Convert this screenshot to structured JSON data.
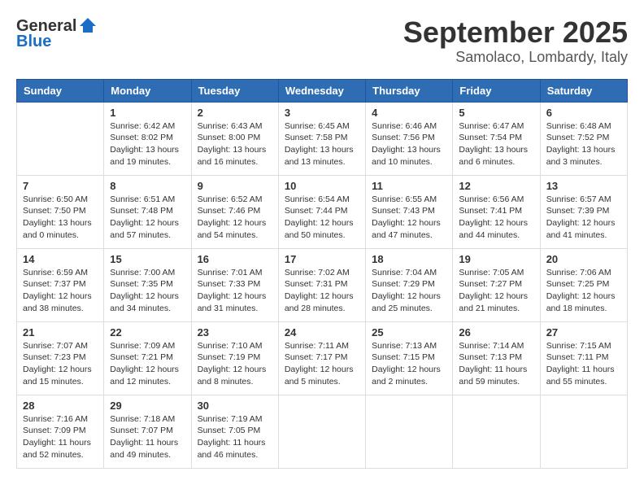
{
  "logo": {
    "general": "General",
    "blue": "Blue"
  },
  "title": "September 2025",
  "location": "Samolaco, Lombardy, Italy",
  "weekdays": [
    "Sunday",
    "Monday",
    "Tuesday",
    "Wednesday",
    "Thursday",
    "Friday",
    "Saturday"
  ],
  "weeks": [
    [
      {
        "day": null,
        "info": null
      },
      {
        "day": "1",
        "info": "Sunrise: 6:42 AM\nSunset: 8:02 PM\nDaylight: 13 hours\nand 19 minutes."
      },
      {
        "day": "2",
        "info": "Sunrise: 6:43 AM\nSunset: 8:00 PM\nDaylight: 13 hours\nand 16 minutes."
      },
      {
        "day": "3",
        "info": "Sunrise: 6:45 AM\nSunset: 7:58 PM\nDaylight: 13 hours\nand 13 minutes."
      },
      {
        "day": "4",
        "info": "Sunrise: 6:46 AM\nSunset: 7:56 PM\nDaylight: 13 hours\nand 10 minutes."
      },
      {
        "day": "5",
        "info": "Sunrise: 6:47 AM\nSunset: 7:54 PM\nDaylight: 13 hours\nand 6 minutes."
      },
      {
        "day": "6",
        "info": "Sunrise: 6:48 AM\nSunset: 7:52 PM\nDaylight: 13 hours\nand 3 minutes."
      }
    ],
    [
      {
        "day": "7",
        "info": "Sunrise: 6:50 AM\nSunset: 7:50 PM\nDaylight: 13 hours\nand 0 minutes."
      },
      {
        "day": "8",
        "info": "Sunrise: 6:51 AM\nSunset: 7:48 PM\nDaylight: 12 hours\nand 57 minutes."
      },
      {
        "day": "9",
        "info": "Sunrise: 6:52 AM\nSunset: 7:46 PM\nDaylight: 12 hours\nand 54 minutes."
      },
      {
        "day": "10",
        "info": "Sunrise: 6:54 AM\nSunset: 7:44 PM\nDaylight: 12 hours\nand 50 minutes."
      },
      {
        "day": "11",
        "info": "Sunrise: 6:55 AM\nSunset: 7:43 PM\nDaylight: 12 hours\nand 47 minutes."
      },
      {
        "day": "12",
        "info": "Sunrise: 6:56 AM\nSunset: 7:41 PM\nDaylight: 12 hours\nand 44 minutes."
      },
      {
        "day": "13",
        "info": "Sunrise: 6:57 AM\nSunset: 7:39 PM\nDaylight: 12 hours\nand 41 minutes."
      }
    ],
    [
      {
        "day": "14",
        "info": "Sunrise: 6:59 AM\nSunset: 7:37 PM\nDaylight: 12 hours\nand 38 minutes."
      },
      {
        "day": "15",
        "info": "Sunrise: 7:00 AM\nSunset: 7:35 PM\nDaylight: 12 hours\nand 34 minutes."
      },
      {
        "day": "16",
        "info": "Sunrise: 7:01 AM\nSunset: 7:33 PM\nDaylight: 12 hours\nand 31 minutes."
      },
      {
        "day": "17",
        "info": "Sunrise: 7:02 AM\nSunset: 7:31 PM\nDaylight: 12 hours\nand 28 minutes."
      },
      {
        "day": "18",
        "info": "Sunrise: 7:04 AM\nSunset: 7:29 PM\nDaylight: 12 hours\nand 25 minutes."
      },
      {
        "day": "19",
        "info": "Sunrise: 7:05 AM\nSunset: 7:27 PM\nDaylight: 12 hours\nand 21 minutes."
      },
      {
        "day": "20",
        "info": "Sunrise: 7:06 AM\nSunset: 7:25 PM\nDaylight: 12 hours\nand 18 minutes."
      }
    ],
    [
      {
        "day": "21",
        "info": "Sunrise: 7:07 AM\nSunset: 7:23 PM\nDaylight: 12 hours\nand 15 minutes."
      },
      {
        "day": "22",
        "info": "Sunrise: 7:09 AM\nSunset: 7:21 PM\nDaylight: 12 hours\nand 12 minutes."
      },
      {
        "day": "23",
        "info": "Sunrise: 7:10 AM\nSunset: 7:19 PM\nDaylight: 12 hours\nand 8 minutes."
      },
      {
        "day": "24",
        "info": "Sunrise: 7:11 AM\nSunset: 7:17 PM\nDaylight: 12 hours\nand 5 minutes."
      },
      {
        "day": "25",
        "info": "Sunrise: 7:13 AM\nSunset: 7:15 PM\nDaylight: 12 hours\nand 2 minutes."
      },
      {
        "day": "26",
        "info": "Sunrise: 7:14 AM\nSunset: 7:13 PM\nDaylight: 11 hours\nand 59 minutes."
      },
      {
        "day": "27",
        "info": "Sunrise: 7:15 AM\nSunset: 7:11 PM\nDaylight: 11 hours\nand 55 minutes."
      }
    ],
    [
      {
        "day": "28",
        "info": "Sunrise: 7:16 AM\nSunset: 7:09 PM\nDaylight: 11 hours\nand 52 minutes."
      },
      {
        "day": "29",
        "info": "Sunrise: 7:18 AM\nSunset: 7:07 PM\nDaylight: 11 hours\nand 49 minutes."
      },
      {
        "day": "30",
        "info": "Sunrise: 7:19 AM\nSunset: 7:05 PM\nDaylight: 11 hours\nand 46 minutes."
      },
      {
        "day": null,
        "info": null
      },
      {
        "day": null,
        "info": null
      },
      {
        "day": null,
        "info": null
      },
      {
        "day": null,
        "info": null
      }
    ]
  ]
}
